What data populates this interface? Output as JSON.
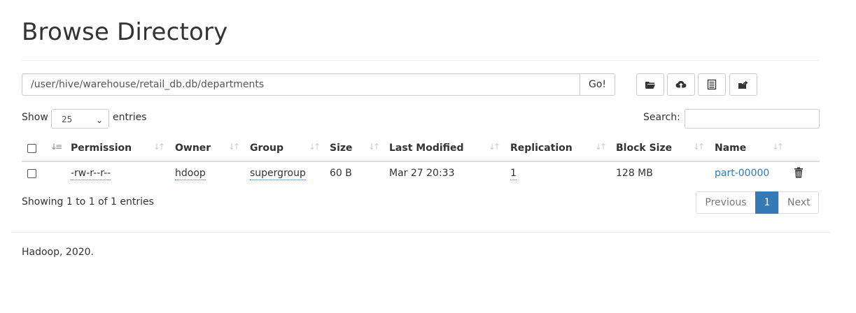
{
  "header": {
    "title": "Browse Directory"
  },
  "path_bar": {
    "value": "/user/hive/warehouse/retail_db.db/departments",
    "go_label": "Go!"
  },
  "toolbar": {
    "icons": [
      "folder-open-icon",
      "upload-cloud-icon",
      "list-alt-icon",
      "cut-paste-icon"
    ]
  },
  "table_controls": {
    "show_label": "Show",
    "page_size": "25",
    "entries_label": "entries",
    "search_label": "Search:",
    "search_value": ""
  },
  "table": {
    "columns": [
      "Permission",
      "Owner",
      "Group",
      "Size",
      "Last Modified",
      "Replication",
      "Block Size",
      "Name"
    ],
    "rows": [
      {
        "permission": "-rw-r--r--",
        "owner": "hdoop",
        "group": "supergroup",
        "size": "60 B",
        "last_modified": "Mar 27 20:33",
        "replication": "1",
        "block_size": "128 MB",
        "name": "part-00000"
      }
    ]
  },
  "pagination": {
    "info": "Showing 1 to 1 of 1 entries",
    "previous": "Previous",
    "current": "1",
    "next": "Next"
  },
  "footer": {
    "text": "Hadoop, 2020."
  },
  "colors": {
    "link": "#337ab7",
    "active_page": "#337ab7",
    "rule": "#dddddd"
  }
}
